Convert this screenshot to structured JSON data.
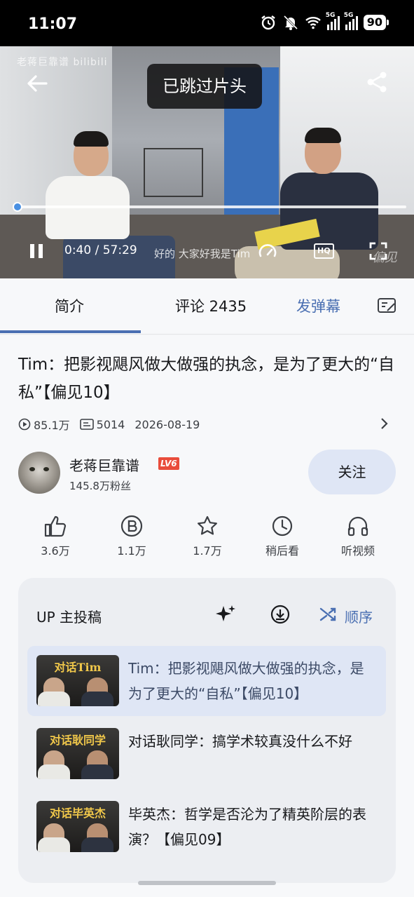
{
  "status_bar": {
    "time": "11:07",
    "battery": "90",
    "net1": "5G",
    "net2": "5G"
  },
  "video": {
    "watermark": "老蒋巨靠谱 bilibili",
    "toast": "已跳过片头",
    "time": "0:40 / 57:29",
    "subtitle": "好的 大家好我是Tim",
    "hq_label": "HQ",
    "corner_mark": "偏见",
    "progress": 0.012
  },
  "tabs": {
    "intro": "简介",
    "comments": "评论 2435",
    "danmaku": "发弹幕"
  },
  "video_info": {
    "title": "Tim：把影视飓风做大做强的执念，是为了更大的“自私”【偏见10】",
    "views": "85.1万",
    "danmaku_count": "5014",
    "date": "2026-08-19"
  },
  "uploader": {
    "name": "老蒋巨靠谱",
    "level": "LV6",
    "fans": "145.8万粉丝",
    "follow_label": "关注"
  },
  "actions": {
    "like": "3.6万",
    "coin": "1.1万",
    "favorite": "1.7万",
    "watch_later": "稍后看",
    "listen": "听视频"
  },
  "playlist": {
    "title": "UP 主投稿",
    "order_label": "顺序",
    "items": [
      {
        "thumb_title": "对话Tim",
        "title": "Tim：把影视飓风做大做强的执念，是为了更大的“自私”【偏见10】"
      },
      {
        "thumb_title": "对话耿同学",
        "title": "对话耿同学：搞学术较真没什么不好"
      },
      {
        "thumb_title": "对话毕英杰",
        "title": "毕英杰：哲学是否沦为了精英阶层的表演？【偏见09】"
      }
    ]
  },
  "colors": {
    "accent": "#4a6fb2",
    "follow_bg": "#dfe6f5",
    "level_badge": "#e94c3b"
  }
}
